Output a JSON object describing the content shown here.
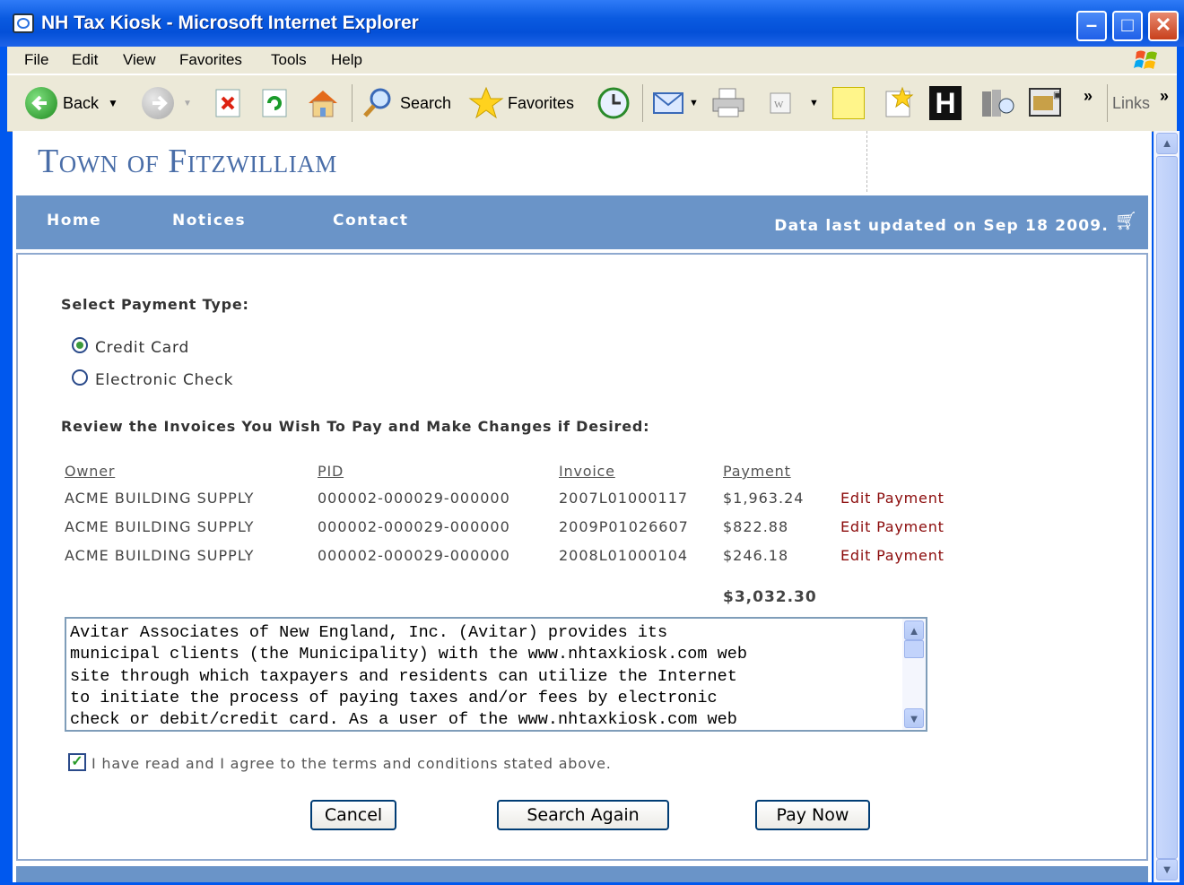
{
  "window": {
    "title": "NH Tax Kiosk - Microsoft Internet Explorer"
  },
  "menu": [
    "File",
    "Edit",
    "View",
    "Favorites",
    "Tools",
    "Help"
  ],
  "toolbar": {
    "back": "Back",
    "search": "Search",
    "favorites": "Favorites",
    "links": "Links",
    "more": "»"
  },
  "site": {
    "town": "Town of Fitzwilliam",
    "nav": [
      "Home",
      "Notices",
      "Contact"
    ],
    "updated": "Data last updated on Sep 18 2009."
  },
  "payment": {
    "heading": "Select Payment Type:",
    "options": [
      {
        "label": "Credit Card",
        "selected": true
      },
      {
        "label": "Electronic Check",
        "selected": false
      }
    ]
  },
  "review": {
    "heading": "Review the Invoices You Wish To Pay and Make Changes if Desired:",
    "columns": [
      "Owner",
      "PID",
      "Invoice",
      "Payment"
    ],
    "rows": [
      {
        "owner": "ACME BUILDING SUPPLY",
        "pid": "000002-000029-000000",
        "invoice": "2007L01000117",
        "payment": "$1,963.24",
        "action": "Edit Payment"
      },
      {
        "owner": "ACME BUILDING SUPPLY",
        "pid": "000002-000029-000000",
        "invoice": "2009P01026607",
        "payment": "$822.88",
        "action": "Edit Payment"
      },
      {
        "owner": "ACME BUILDING SUPPLY",
        "pid": "000002-000029-000000",
        "invoice": "2008L01000104",
        "payment": "$246.18",
        "action": "Edit Payment"
      }
    ],
    "total": "$3,032.30"
  },
  "terms": {
    "text": "Avitar Associates of New England, Inc. (Avitar) provides its\nmunicipal clients (the Municipality) with the www.nhtaxkiosk.com web\nsite through which taxpayers and residents can utilize the Internet\nto initiate the process of paying taxes and/or fees by electronic\ncheck or debit/credit card. As a user of the www.nhtaxkiosk.com web",
    "agree_label": "I have read and I agree to the terms and conditions stated above.",
    "agreed": true
  },
  "buttons": {
    "cancel": "Cancel",
    "search_again": "Search Again",
    "pay_now": "Pay Now"
  },
  "colors": {
    "nav_bar": "#6a94c8",
    "town_title": "#4a6ea8",
    "edit_link": "#8b0a0a",
    "titlebar": "#0a5ae0"
  }
}
